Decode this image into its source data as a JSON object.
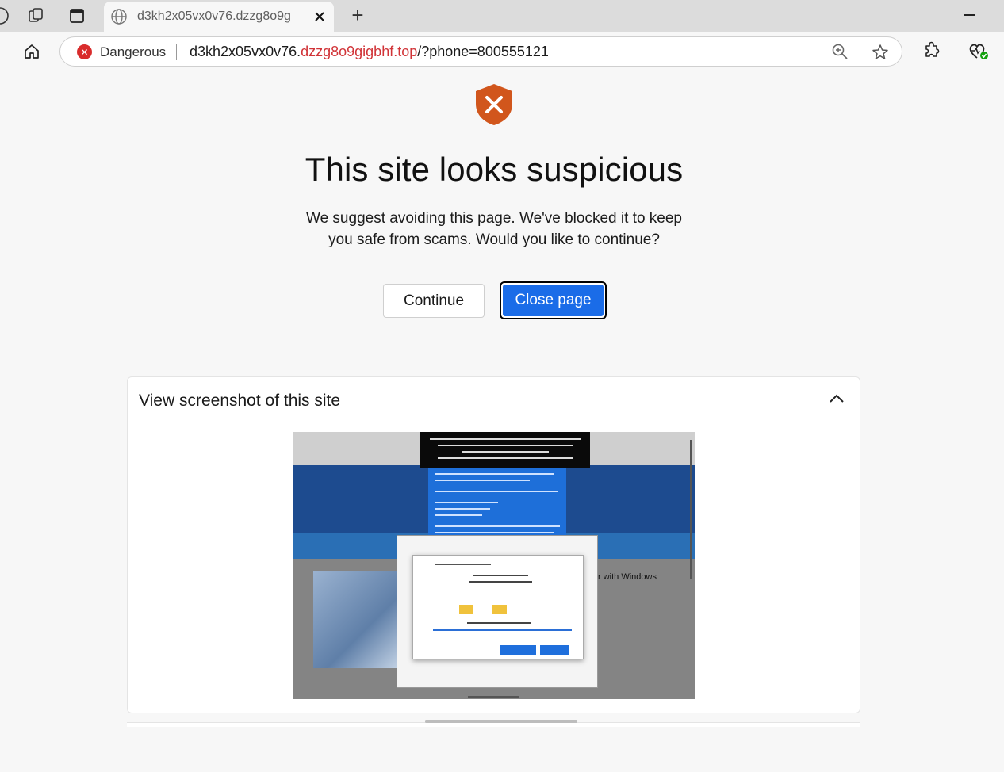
{
  "browser": {
    "tab": {
      "title": "d3kh2x05vx0v76.dzzg8o9g"
    },
    "new_tab_label": "+",
    "omnibox": {
      "security_label": "Dangerous",
      "url_prefix": "d3kh2x05vx0v76.",
      "url_domain": "dzzg8o9gigbhf.top",
      "url_suffix": "/?phone=800555121"
    }
  },
  "page": {
    "title": "This site looks suspicious",
    "subtitle": "We suggest avoiding this page. We've blocked it to keep you safe from scams. Would you like to continue?",
    "continue_label": "Continue",
    "close_label": "Close page"
  },
  "screenshot_panel": {
    "title": "View screenshot of this site",
    "preview_text": "r with Windows"
  },
  "colors": {
    "danger": "#d92c2c",
    "primary": "#1a6ce8",
    "shield": "#d1561c"
  }
}
